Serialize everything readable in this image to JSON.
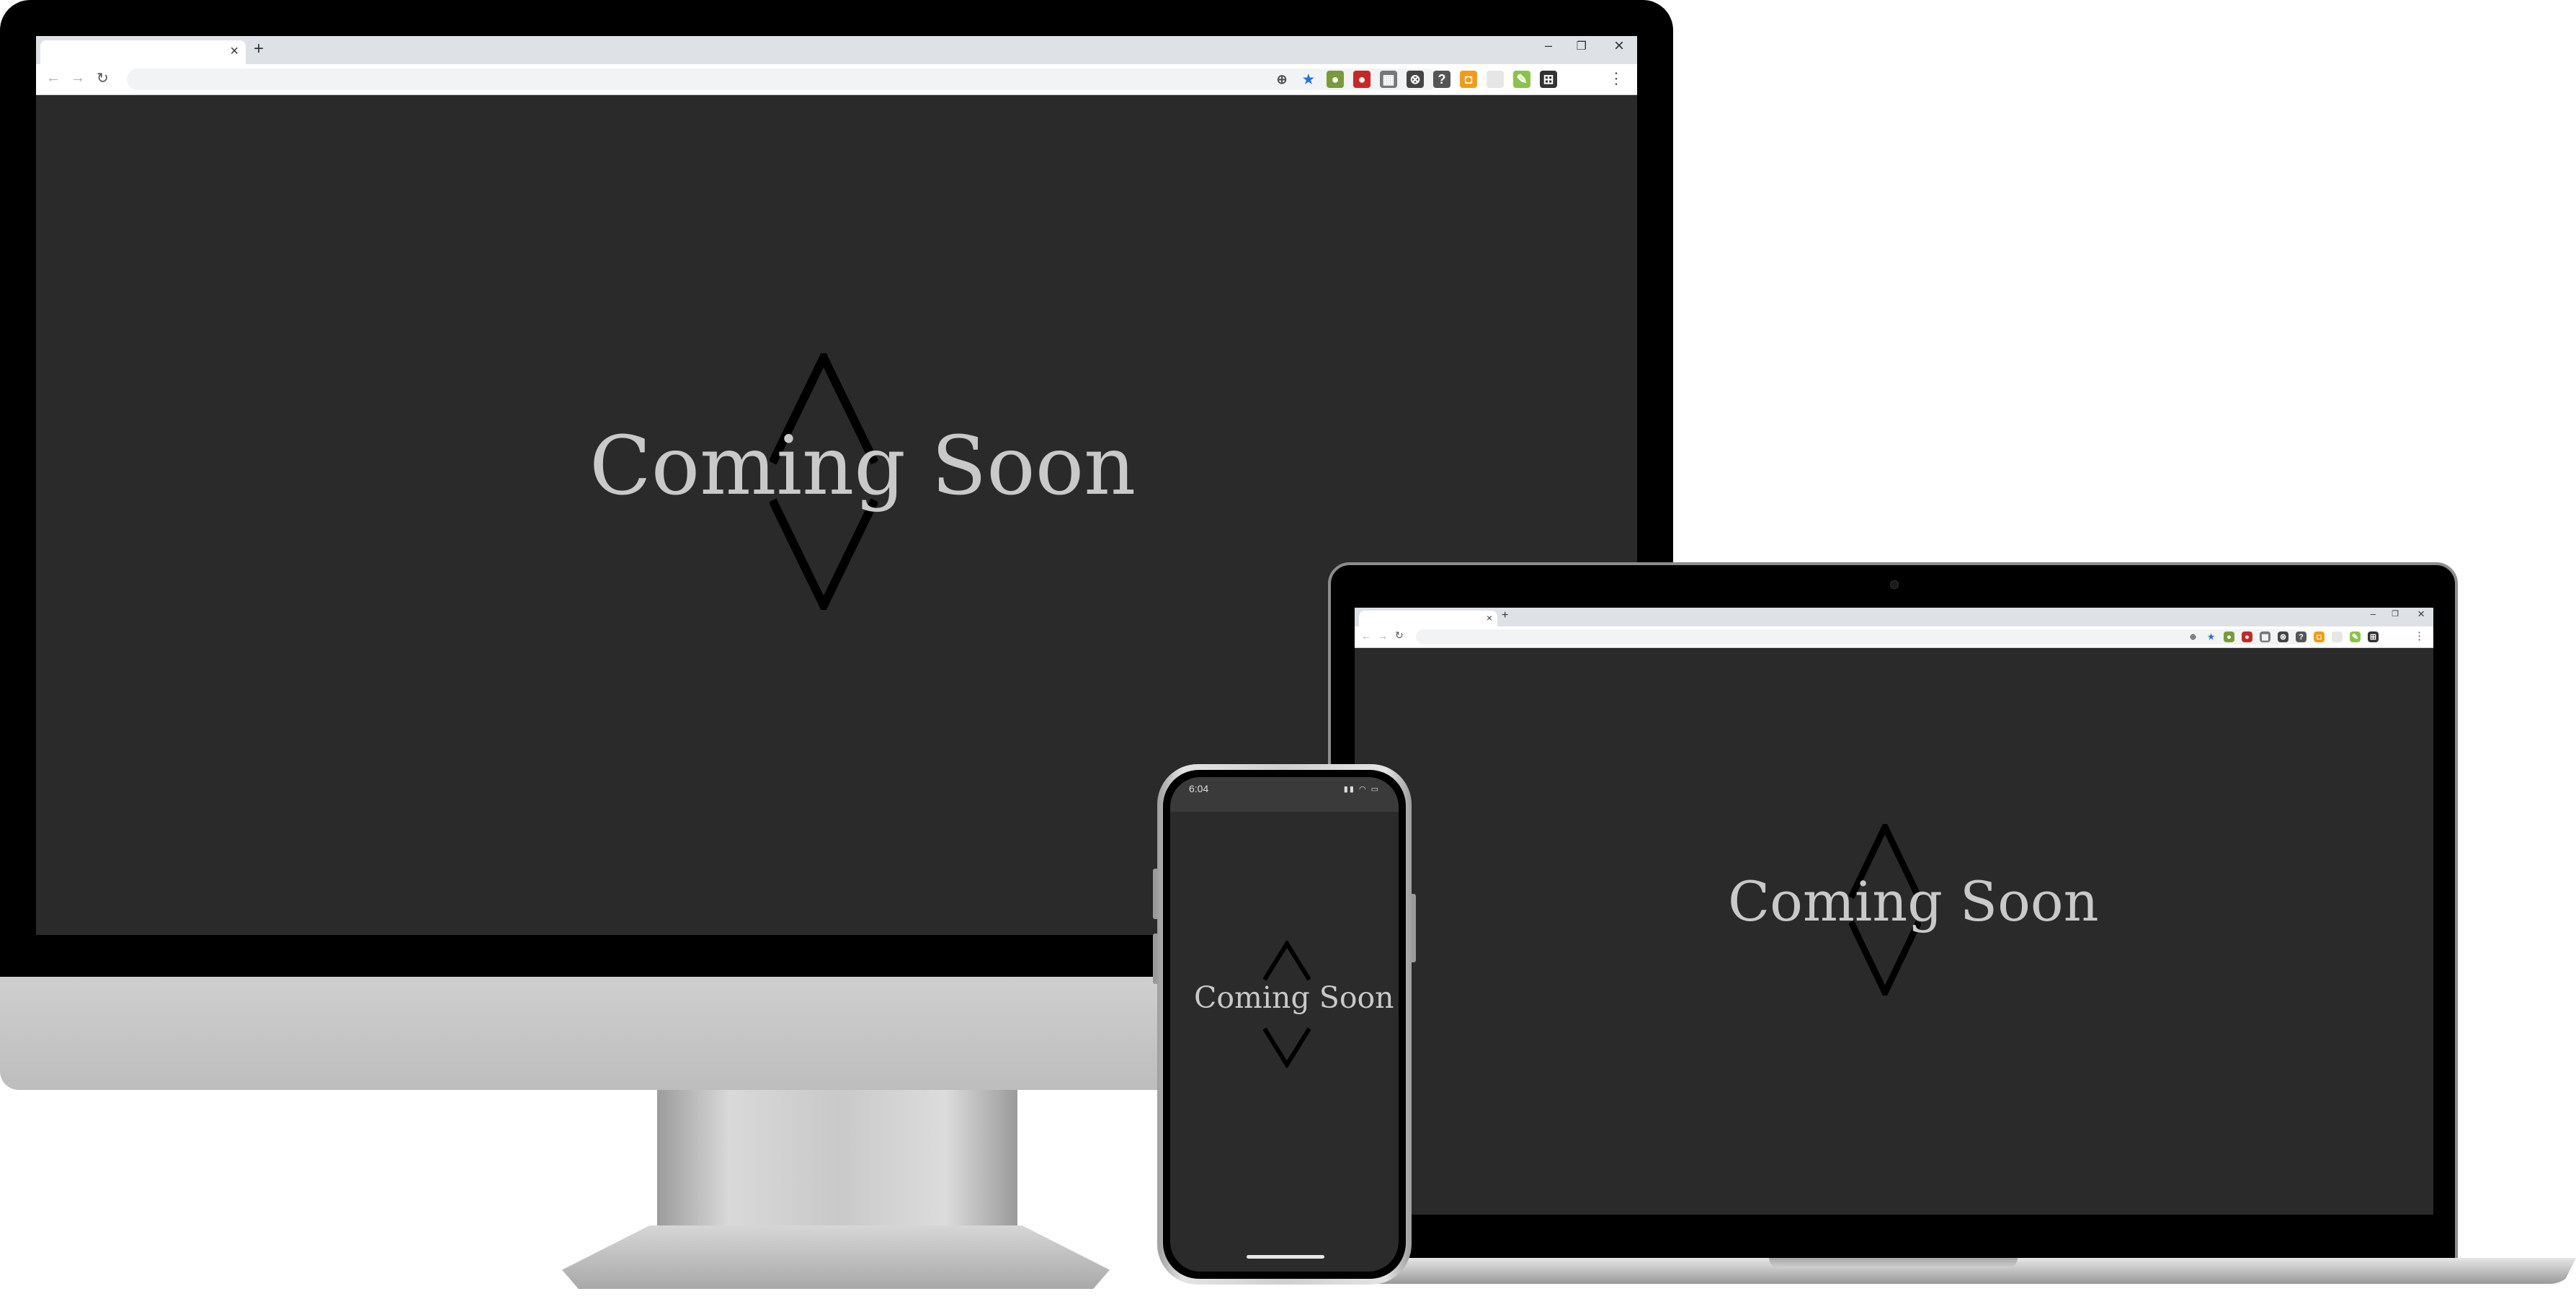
{
  "page": {
    "headline": "Coming Soon"
  },
  "browser": {
    "tab_close": "×",
    "new_tab": "+",
    "minimize": "–",
    "restore": "❐",
    "close": "×",
    "back": "←",
    "forward": "→",
    "reload": "↻",
    "menu": "⋮",
    "bookmark_star": "★"
  },
  "phone": {
    "time": "6:04",
    "status_icons": "▮▮ ◠ ▭"
  },
  "colors": {
    "background": "#2a2a2a",
    "headline": "#c9c9c9",
    "logo": "#000000"
  },
  "extensions": [
    {
      "name": "ext-location-icon",
      "glyph": "⊕",
      "color": "#ffffff"
    },
    {
      "name": "ext-star-icon",
      "glyph": "★",
      "color": "#ffffff"
    },
    {
      "name": "ext-tampermonkey-icon",
      "glyph": "●",
      "color": "#7a9a3a"
    },
    {
      "name": "ext-adblock-icon",
      "glyph": "●",
      "color": "#c62828"
    },
    {
      "name": "ext-store-icon",
      "glyph": "▦",
      "color": "#777777"
    },
    {
      "name": "ext-globe-icon",
      "glyph": "⊗",
      "color": "#444444"
    },
    {
      "name": "ext-help-icon",
      "glyph": "?",
      "color": "#555555"
    },
    {
      "name": "ext-orange-icon",
      "glyph": "◘",
      "color": "#f39c12"
    },
    {
      "name": "ext-blank-icon",
      "glyph": "",
      "color": "#e6e6e6"
    },
    {
      "name": "ext-pen-icon",
      "glyph": "✎",
      "color": "#8bc34a"
    },
    {
      "name": "ext-crop-icon",
      "glyph": "⊞",
      "color": "#333333"
    }
  ]
}
